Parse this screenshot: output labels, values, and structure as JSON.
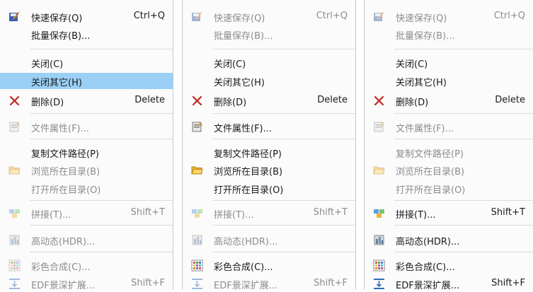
{
  "menus": [
    {
      "items": {
        "quicksave": {
          "label": "快速保存(Q)",
          "shortcut": "Ctrl+Q"
        },
        "batchsave": {
          "label": "批量保存(B)..."
        },
        "close": {
          "label": "关闭(C)"
        },
        "closeothers": {
          "label": "关闭其它(H)"
        },
        "delete": {
          "label": "删除(D)",
          "shortcut": "Delete"
        },
        "fileprops": {
          "label": "文件属性(F)..."
        },
        "copypath": {
          "label": "复制文件路径(P)"
        },
        "browsedir": {
          "label": "浏览所在目录(B)"
        },
        "opendir": {
          "label": "打开所在目录(O)"
        },
        "stitch": {
          "label": "拼接(T)...",
          "shortcut": "Shift+T"
        },
        "hdr": {
          "label": "高动态(HDR)..."
        },
        "colorcomp": {
          "label": "彩色合成(C)..."
        },
        "edf": {
          "label": "EDF景深扩展...",
          "shortcut": "Shift+F"
        }
      }
    },
    {
      "items": {
        "quicksave": {
          "label": "快速保存(Q)",
          "shortcut": "Ctrl+Q"
        },
        "batchsave": {
          "label": "批量保存(B)..."
        },
        "close": {
          "label": "关闭(C)"
        },
        "closeothers": {
          "label": "关闭其它(H)"
        },
        "delete": {
          "label": "删除(D)",
          "shortcut": "Delete"
        },
        "fileprops": {
          "label": "文件属性(F)..."
        },
        "copypath": {
          "label": "复制文件路径(P)"
        },
        "browsedir": {
          "label": "浏览所在目录(B)"
        },
        "opendir": {
          "label": "打开所在目录(O)"
        },
        "stitch": {
          "label": "拼接(T)...",
          "shortcut": "Shift+T"
        },
        "hdr": {
          "label": "高动态(HDR)..."
        },
        "colorcomp": {
          "label": "彩色合成(C)..."
        },
        "edf": {
          "label": "EDF景深扩展...",
          "shortcut": "Shift+F"
        }
      }
    },
    {
      "items": {
        "quicksave": {
          "label": "快速保存(Q)",
          "shortcut": "Ctrl+Q"
        },
        "batchsave": {
          "label": "批量保存(B)..."
        },
        "close": {
          "label": "关闭(C)"
        },
        "closeothers": {
          "label": "关闭其它(H)"
        },
        "delete": {
          "label": "删除(D)",
          "shortcut": "Delete"
        },
        "fileprops": {
          "label": "文件属性(F)..."
        },
        "copypath": {
          "label": "复制文件路径(P)"
        },
        "browsedir": {
          "label": "浏览所在目录(B)"
        },
        "opendir": {
          "label": "打开所在目录(O)"
        },
        "stitch": {
          "label": "拼接(T)...",
          "shortcut": "Shift+T"
        },
        "hdr": {
          "label": "高动态(HDR)..."
        },
        "colorcomp": {
          "label": "彩色合成(C)..."
        },
        "edf": {
          "label": "EDF景深扩展...",
          "shortcut": "Shift+F"
        }
      }
    }
  ],
  "colors": {
    "highlight": "#9bd0f6",
    "disabled_text": "#8c8c8c",
    "delete_icon": "#c0281c",
    "folder_icon": "#f2b632"
  }
}
